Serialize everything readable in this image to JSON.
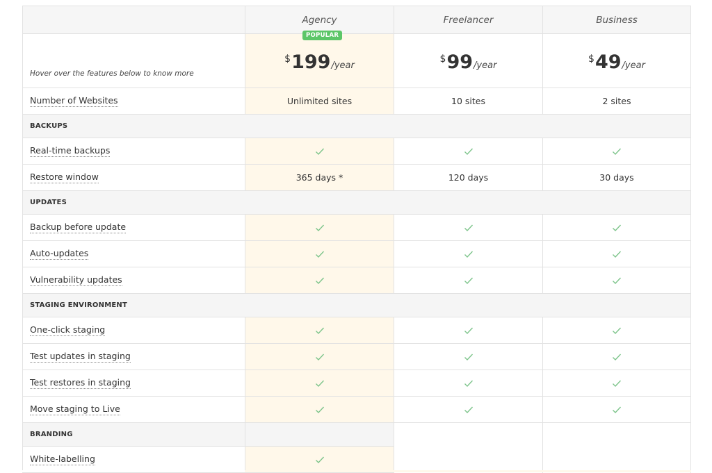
{
  "plans": [
    {
      "name": "Agency",
      "currency": "$",
      "price": "199",
      "period": "/year",
      "badge": "POPULAR"
    },
    {
      "name": "Freelancer",
      "currency": "$",
      "price": "99",
      "period": "/year"
    },
    {
      "name": "Business",
      "currency": "$",
      "price": "49",
      "period": "/year"
    }
  ],
  "hint": "Hover over the features below to know more",
  "websites": {
    "label": "Number of Websites",
    "values": [
      "Unlimited sites",
      "10 sites",
      "2 sites"
    ]
  },
  "backups": {
    "title": "BACKUPS",
    "realtime": {
      "label": "Real-time backups"
    },
    "restore": {
      "label": "Restore window",
      "values": [
        "365 days *",
        "120 days",
        "30 days"
      ]
    }
  },
  "updates": {
    "title": "UPDATES",
    "items": [
      {
        "label": "Backup before update"
      },
      {
        "label": "Auto-updates"
      },
      {
        "label": "Vulnerability updates"
      }
    ]
  },
  "staging": {
    "title": "STAGING ENVIRONMENT",
    "items": [
      {
        "label": "One-click staging"
      },
      {
        "label": "Test updates in staging"
      },
      {
        "label": "Test restores in staging"
      },
      {
        "label": "Move staging to Live"
      }
    ]
  },
  "branding": {
    "title": "BRANDING",
    "items": [
      {
        "label": "White-labelling"
      }
    ]
  },
  "colors": {
    "highlight": "#fff8ea",
    "check": "#7cc48a",
    "badge": "#5cc668",
    "section_bg": "#f5f5f5"
  },
  "icons": {
    "included": "check-icon"
  }
}
